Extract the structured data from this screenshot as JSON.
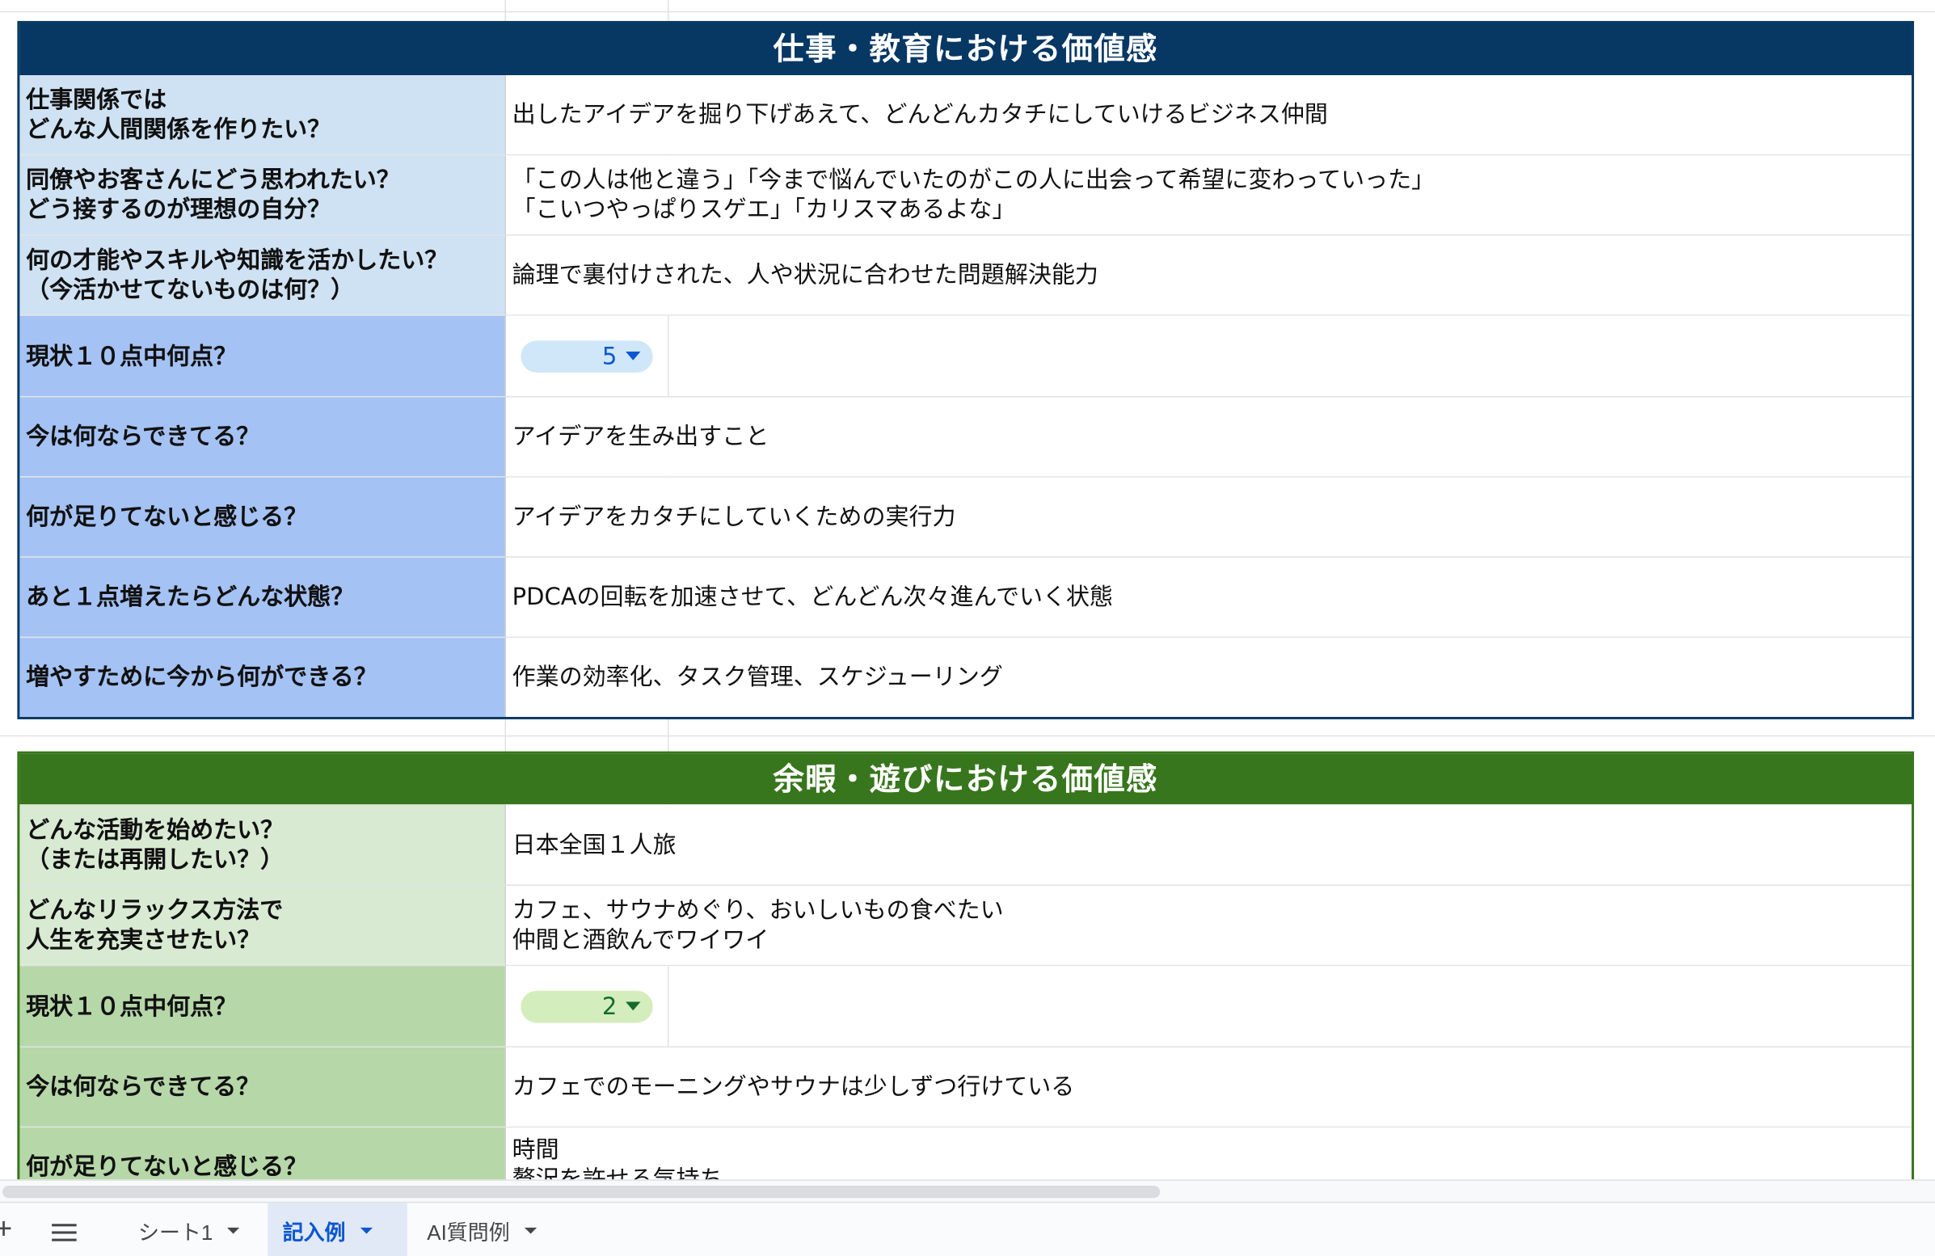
{
  "sections": [
    {
      "title": "仕事・教育における価値感",
      "theme": "blue",
      "colors": {
        "header": "#073763",
        "label_light": "#cfe2f3",
        "label_mid": "#a4c2f4",
        "border": "#0b3a63"
      },
      "rows": [
        {
          "question": "仕事関係では\nどんな人間関係を作りたい？",
          "answer": "出したアイデアを掘り下げあえて、どんどんカタチにしていけるビジネス仲間"
        },
        {
          "question": "同僚やお客さんにどう思われたい？\nどう接するのが理想の自分？",
          "answer": "「この人は他と違う」「今まで悩んでいたのがこの人に出会って希望に変わっていった」\n「こいつやっぱりスゲエ」「カリスマあるよな」"
        },
        {
          "question": "何の才能やスキルや知識を活かしたい？\n（今活かせてないものは何？）",
          "answer": "論理で裏付けされた、人や状況に合わせた問題解決能力"
        },
        {
          "question": "現状１０点中何点？",
          "score": "5"
        },
        {
          "question": "今は何ならできてる？",
          "answer": "アイデアを生み出すこと"
        },
        {
          "question": "何が足りてないと感じる？",
          "answer": "アイデアをカタチにしていくための実行力"
        },
        {
          "question": "あと１点増えたらどんな状態？",
          "answer": "PDCAの回転を加速させて、どんどん次々進んでいく状態"
        },
        {
          "question": "増やすために今から何ができる？",
          "answer": "作業の効率化、タスク管理、スケジューリング"
        }
      ]
    },
    {
      "title": "余暇・遊びにおける価値感",
      "theme": "green",
      "colors": {
        "header": "#38761d",
        "label_light": "#d9ead3",
        "label_mid": "#b6d7a8",
        "border": "#38761d"
      },
      "rows": [
        {
          "question": "どんな活動を始めたい？\n（または再開したい？）",
          "answer": "日本全国１人旅"
        },
        {
          "question": "どんなリラックス方法で\n人生を充実させたい？",
          "answer": "カフェ、サウナめぐり、おいしいもの食べたい\n仲間と酒飲んでワイワイ"
        },
        {
          "question": "現状１０点中何点？",
          "score": "2"
        },
        {
          "question": "今は何ならできてる？",
          "answer": "カフェでのモーニングやサウナは少しずつ行けている"
        },
        {
          "question": "何が足りてないと感じる？",
          "answer": "時間\n贅沢を許せる気持ち"
        }
      ]
    }
  ],
  "sheet_tabs": [
    {
      "label": "シート1",
      "active": false
    },
    {
      "label": "記入例",
      "active": true
    },
    {
      "label": "AI質問例",
      "active": false
    }
  ],
  "toolbar": {
    "add_icon": "plus-icon",
    "menu_icon": "hamburger-menu-icon",
    "add_glyph": "+"
  }
}
